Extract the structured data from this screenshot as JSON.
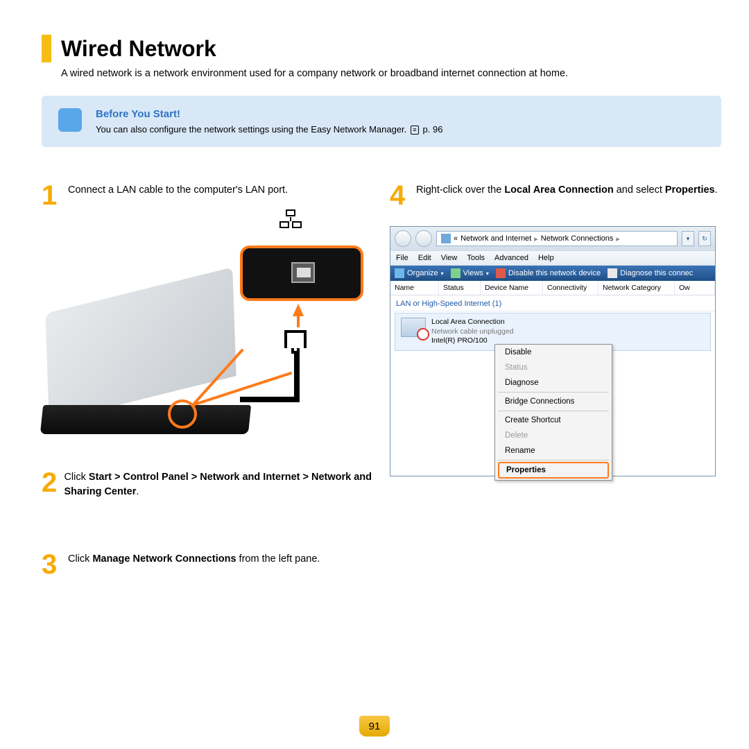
{
  "title": "Wired Network",
  "subtitle": "A wired network is a network environment used for a company network or broadband internet connection at home.",
  "callout": {
    "title": "Before You Start!",
    "text": "You can also configure the network settings using the Easy Network Manager. ",
    "page_ref": "p. 96"
  },
  "steps": {
    "s1": {
      "num": "1",
      "text": "Connect a LAN cable to the computer's LAN port."
    },
    "s2": {
      "num": "2",
      "pre": "Click ",
      "bold": "Start > Control Panel > Network and Internet > Network and Sharing Center",
      "post": "."
    },
    "s3": {
      "num": "3",
      "pre": "Click ",
      "bold": "Manage Network Connections",
      "post": " from the left pane."
    },
    "s4": {
      "num": "4",
      "pre": "Right-click over the ",
      "b1": "Local Area Connection",
      "mid": " and select ",
      "b2": "Properties",
      "post": "."
    }
  },
  "win": {
    "breadcrumb": {
      "pre": "«",
      "a": "Network and Internet",
      "b": "Network Connections"
    },
    "menubar": [
      "File",
      "Edit",
      "View",
      "Tools",
      "Advanced",
      "Help"
    ],
    "toolbar": {
      "organize": "Organize",
      "views": "Views",
      "disable": "Disable this network device",
      "diagnose": "Diagnose this connec"
    },
    "columns": [
      "Name",
      "Status",
      "Device Name",
      "Connectivity",
      "Network Category",
      "Ow"
    ],
    "group": "LAN or High-Speed Internet (1)",
    "conn": {
      "name": "Local Area Connection",
      "status": "Network cable unplugged",
      "device": "Intel(R) PRO/100"
    },
    "ctx": {
      "disable": "Disable",
      "status": "Status",
      "diagnose": "Diagnose",
      "bridge": "Bridge Connections",
      "shortcut": "Create Shortcut",
      "delete": "Delete",
      "rename": "Rename",
      "properties": "Properties"
    }
  },
  "page_number": "91"
}
